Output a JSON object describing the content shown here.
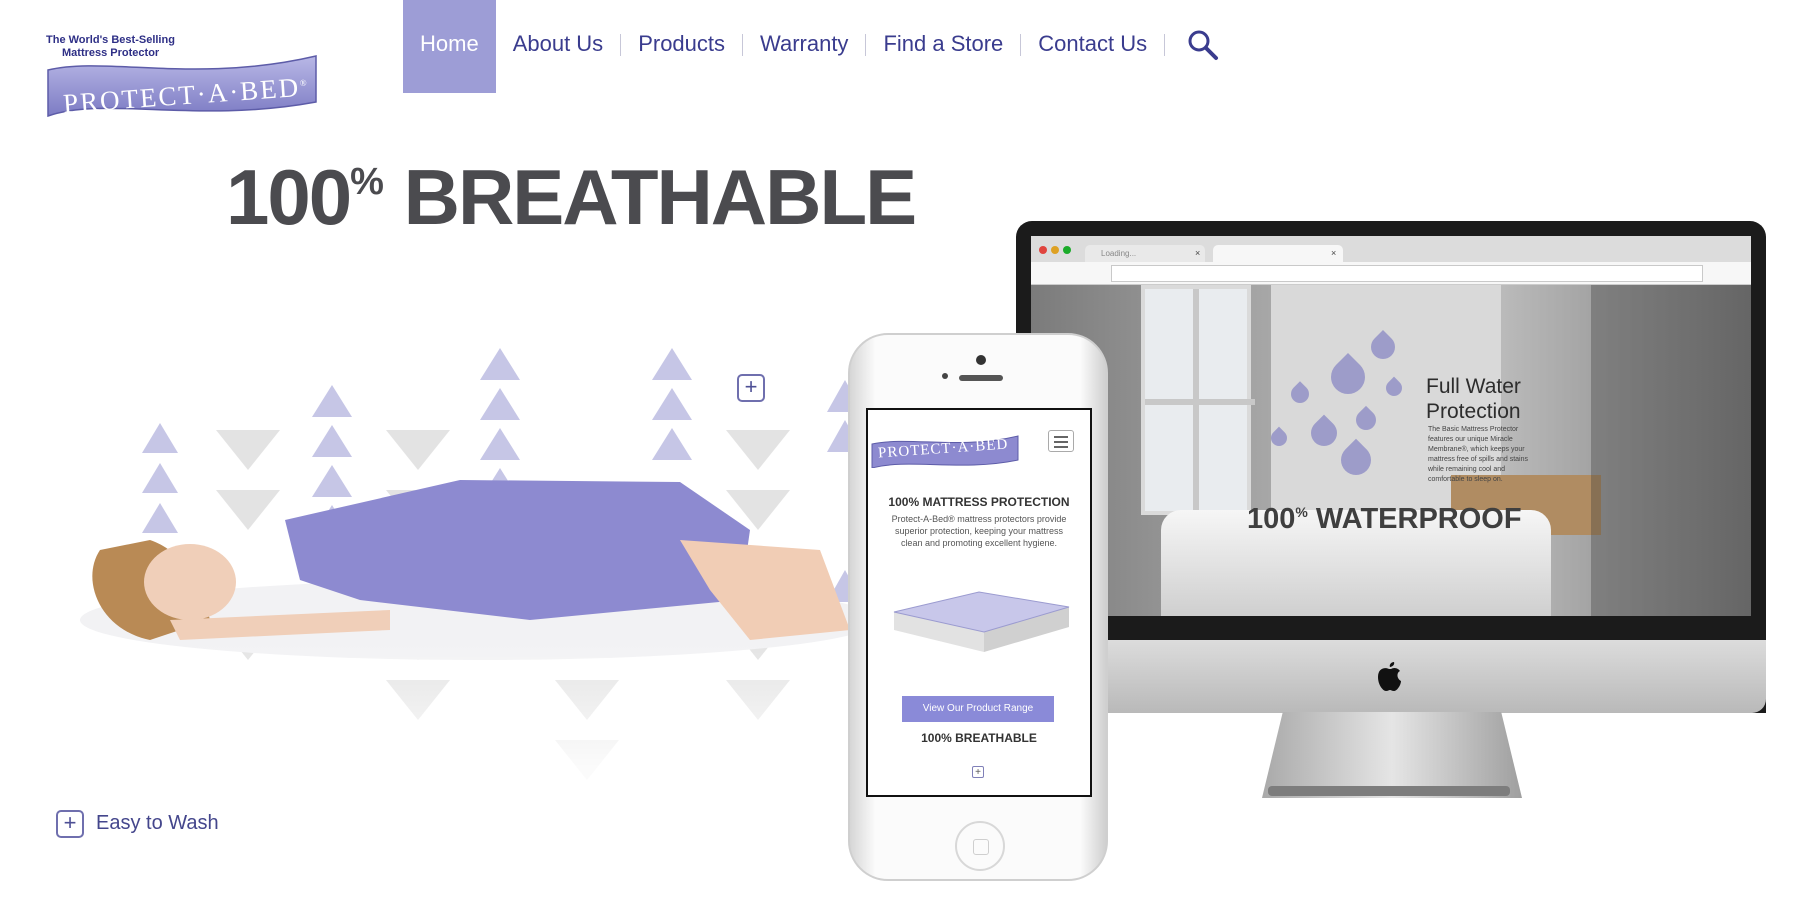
{
  "logo": {
    "tagline_line1": "The World's Best-Selling",
    "tagline_line2": "Mattress Protector",
    "brand": "PROTECT·A·BED",
    "reg": "®"
  },
  "nav": {
    "items": [
      {
        "label": "Home",
        "active": true
      },
      {
        "label": "About Us"
      },
      {
        "label": "Products"
      },
      {
        "label": "Warranty"
      },
      {
        "label": "Find a Store"
      },
      {
        "label": "Contact Us"
      }
    ],
    "search_icon": "search-icon"
  },
  "hero": {
    "number": "100",
    "percent": "%",
    "word": "BREATHABLE",
    "wash_label": "Easy to Wash",
    "plus": "+"
  },
  "desktop_mockup": {
    "tab_loading": "Loading...",
    "tab_close": "×",
    "feature_title_line1": "Full Water",
    "feature_title_line2": "Protection",
    "feature_text": "The Basic Mattress Protector features our unique Miracle Membrane®, which keeps your mattress free of spills and stains while remaining cool and comfortable to sleep on.",
    "headline_number": "100",
    "headline_percent": "%",
    "headline_word": "WATERPROOF",
    "apple_logo": ""
  },
  "mobile_mockup": {
    "brand": "PROTECT·A·BED",
    "heading": "100% MATTRESS PROTECTION",
    "text": "Protect-A-Bed® mattress protectors provide superior protection, keeping your mattress clean and promoting excellent hygiene.",
    "button": "View Our Product Range",
    "heading2": "100% BREATHABLE",
    "plus": "+"
  },
  "colors": {
    "brand_purple": "#9d9dd6",
    "nav_text": "#3a3c8e",
    "hero_text": "#4b4b4f",
    "button": "#8a8ad8"
  }
}
